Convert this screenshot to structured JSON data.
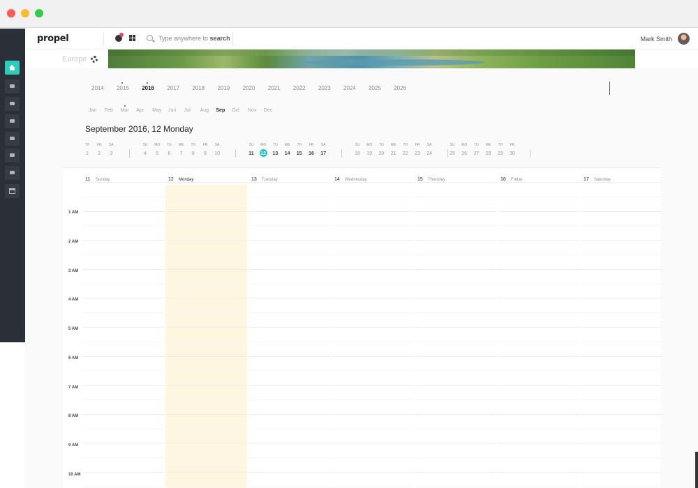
{
  "app": {
    "logo": "propel"
  },
  "header": {
    "search_placeholder_prefix": "Type anywhere to",
    "search_placeholder_bold": "search",
    "user_name": "Mark Smith"
  },
  "banner": {
    "region": "Europe"
  },
  "years": {
    "items": [
      "2014",
      "2015",
      "2016",
      "2017",
      "2018",
      "2019",
      "2020",
      "2021",
      "2022",
      "2023",
      "2024",
      "2025",
      "2026"
    ],
    "selected": "2016",
    "marked": [
      "2015",
      "2016"
    ]
  },
  "months": {
    "items": [
      "Jan",
      "Feb",
      "Mar",
      "Apr",
      "May",
      "Jun",
      "Jul",
      "Aug",
      "Sep",
      "Oct",
      "Nov",
      "Dec"
    ],
    "selected": "Sep",
    "marked": [
      "Mar"
    ]
  },
  "title": "September 2016, 12 Monday",
  "mini_calendar": {
    "weeks": [
      {
        "days": [
          [
            "TH",
            "1"
          ],
          [
            "FR",
            "2"
          ],
          [
            "SA",
            "3"
          ]
        ]
      },
      {
        "days": [
          [
            "SU",
            "4"
          ],
          [
            "MO",
            "5"
          ],
          [
            "TU",
            "6"
          ],
          [
            "WE",
            "7"
          ],
          [
            "TH",
            "8"
          ],
          [
            "FR",
            "9"
          ],
          [
            "SA",
            "10"
          ]
        ]
      },
      {
        "days": [
          [
            "SU",
            "11"
          ],
          [
            "MO",
            "12"
          ],
          [
            "TU",
            "13"
          ],
          [
            "WE",
            "14"
          ],
          [
            "TH",
            "15"
          ],
          [
            "FR",
            "16"
          ],
          [
            "SA",
            "17"
          ]
        ],
        "current": true
      },
      {
        "days": [
          [
            "SU",
            "18"
          ],
          [
            "MO",
            "19"
          ],
          [
            "TU",
            "20"
          ],
          [
            "WE",
            "21"
          ],
          [
            "TH",
            "22"
          ],
          [
            "FR",
            "23"
          ],
          [
            "SA",
            "24"
          ]
        ]
      },
      {
        "days": [
          [
            "SU",
            "25"
          ],
          [
            "MO",
            "26"
          ],
          [
            "TU",
            "27"
          ],
          [
            "WE",
            "28"
          ],
          [
            "TH",
            "29"
          ],
          [
            "FR",
            "30"
          ]
        ]
      }
    ],
    "today": "12"
  },
  "week": {
    "days": [
      {
        "num": "11",
        "name": "Sunday"
      },
      {
        "num": "12",
        "name": "Monday",
        "current": true
      },
      {
        "num": "13",
        "name": "Tuesday"
      },
      {
        "num": "14",
        "name": "Wednesday"
      },
      {
        "num": "15",
        "name": "Thursday"
      },
      {
        "num": "16",
        "name": "Friday"
      },
      {
        "num": "17",
        "name": "Saturday"
      }
    ],
    "hours": [
      "1 AM",
      "2 AM",
      "3 AM",
      "4 AM",
      "5 AM",
      "6 AM",
      "7 AM",
      "8 AM",
      "9 AM",
      "10 AM"
    ]
  },
  "colors": {
    "accent": "#2ccbbc",
    "today": "#1fc3c3",
    "current_day": "#fff6e1",
    "sidebar": "#2a2f38",
    "notification": "#f0386b"
  },
  "icons": {
    "sidebar": [
      "home-icon",
      "panel-icon",
      "panel-icon",
      "panel-icon",
      "panel-icon",
      "panel-icon",
      "panel-icon",
      "calendar-icon"
    ],
    "header": [
      "globe-icon",
      "apps-grid-icon",
      "search-icon"
    ],
    "settings": "gear-icon"
  }
}
